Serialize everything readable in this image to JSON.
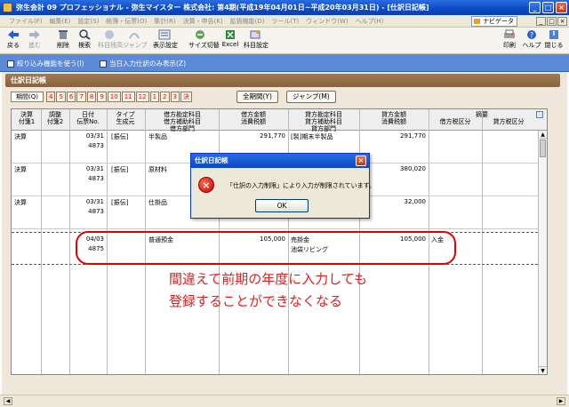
{
  "window": {
    "title": "弥生会計 09 プロフェッショナル - 弥生マイスター 株式会社: 第4期(平成19年04月01日~平成20年03月31日) - [仕訳日記帳]",
    "minimize": "_",
    "maximize": "□",
    "close": "×"
  },
  "menu": {
    "items": [
      "ファイル(F)",
      "編集(E)",
      "設定(S)",
      "帳簿・伝票(O)",
      "集計(R)",
      "決算・申告(K)",
      "拡張機能(D)",
      "ツール(T)",
      "ウィンドウ(W)",
      "ヘルプ(H)"
    ],
    "navi_label": "ナビゲータ",
    "mdi_min": "_",
    "mdi_max": "□",
    "mdi_close": "×"
  },
  "toolbar": {
    "left": [
      {
        "label": "戻る",
        "icon": "back-icon",
        "enabled": true
      },
      {
        "label": "進む",
        "icon": "forward-icon",
        "enabled": false
      },
      {
        "label": "削除",
        "icon": "delete-icon",
        "enabled": true
      },
      {
        "label": "検索",
        "icon": "search-icon",
        "enabled": true
      },
      {
        "label": "科目残高",
        "icon": "account-balance-icon",
        "enabled": false
      },
      {
        "label": "ジャンプ",
        "icon": "jump-icon",
        "enabled": false
      },
      {
        "label": "表示設定",
        "icon": "display-settings-icon",
        "enabled": true
      },
      {
        "label": "サイズ切替",
        "icon": "resize-icon",
        "enabled": true
      },
      {
        "label": "Excel",
        "icon": "excel-icon",
        "enabled": true
      },
      {
        "label": "科目設定",
        "icon": "account-settings-icon",
        "enabled": true
      }
    ],
    "right": [
      {
        "label": "印刷",
        "icon": "print-icon",
        "enabled": true
      },
      {
        "label": "ヘルプ",
        "icon": "help-icon",
        "enabled": true
      },
      {
        "label": "閉じる",
        "icon": "close-icon",
        "enabled": true
      }
    ]
  },
  "options": {
    "filter_label": "絞り込み機能を使う(I)",
    "today_label": "当日入力仕訳のみ表示(Z)"
  },
  "section_title": "仕訳日記帳",
  "periods": {
    "first": "期間(Q)",
    "months": [
      "4",
      "5",
      "6",
      "7",
      "8",
      "9",
      "10",
      "11",
      "12",
      "1",
      "2",
      "3",
      "決"
    ],
    "all_button": "全期間(Y)",
    "jump_button": "ジャンプ(M)"
  },
  "table": {
    "header_row1": [
      "決算",
      "調整",
      "日付",
      "タイプ",
      "借方勘定科目",
      "借方金額",
      "貸方勘定科目",
      "貸方金額",
      "摘要"
    ],
    "header_row2": [
      "付箋1",
      "付箋2",
      "伝票No.",
      "生成元",
      "借方補助科目",
      "消費税額",
      "貸方補助科目",
      "消費税額",
      "借方税区分",
      "貸方税区分"
    ],
    "header_row3": [
      "借方部門",
      "貸方部門"
    ],
    "rows": [
      {
        "kessan": "決算",
        "date": "03/31",
        "no": "4873",
        "type": "[振伝]",
        "debit_account": "半製品",
        "debit_amount": "291,770",
        "credit_account": "[製]期末半製品",
        "credit_amount": "291,770",
        "debit_sub": "",
        "credit_sub": ""
      },
      {
        "kessan": "決算",
        "date": "03/31",
        "no": "4873",
        "type": "[振伝]",
        "debit_account": "原材料",
        "debit_amount": "",
        "credit_account": "",
        "credit_amount": "380,020",
        "debit_sub": "",
        "credit_sub": ""
      },
      {
        "kessan": "決算",
        "date": "03/31",
        "no": "4873",
        "type": "[振伝]",
        "debit_account": "仕掛品",
        "debit_amount": "",
        "credit_account": "",
        "credit_amount": "32,000",
        "debit_sub": "",
        "credit_sub": ""
      },
      {
        "kessan": "",
        "date": "04/03",
        "no": "4875",
        "type": "",
        "debit_account": "普通預金",
        "debit_amount": "105,000",
        "credit_account": "売掛金",
        "credit_amount": "105,000",
        "debit_sub": "",
        "credit_sub": "池袋リビング",
        "memo": "入金"
      }
    ]
  },
  "callout": {
    "line1": "間違えて前期の年度に入力しても",
    "line2": "登録することができなくなる"
  },
  "dialog": {
    "title": "仕訳日記帳",
    "message": "「仕訳の入力制限」により入力が制限されています。",
    "ok": "OK",
    "error_glyph": "×",
    "close": "×"
  },
  "colors": {
    "accent": "#0b49c4",
    "callout": "#e02020",
    "section": "#8a6440"
  }
}
